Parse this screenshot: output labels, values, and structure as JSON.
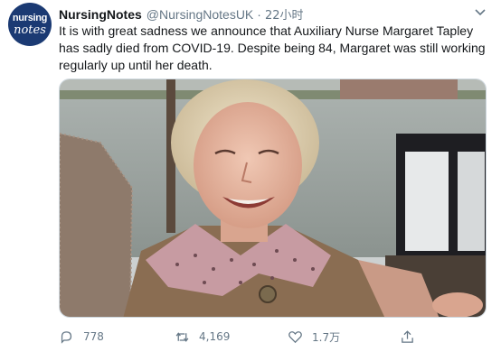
{
  "tweet": {
    "author_name": "NursingNotes",
    "handle": "@NursingNotesUK",
    "separator": "·",
    "timestamp": "22小时",
    "avatar_text_line1": "nursing",
    "avatar_text_line2": "notes",
    "body": "It is with great sadness we announce that Auxiliary Nurse Margaret Tapley has sadly died from COVID-19. Despite being 84, Margaret was still working regularly up until her death."
  },
  "actions": {
    "reply_count": "778",
    "retweet_count": "4,169",
    "like_count": "1.7万"
  },
  "colors": {
    "avatar_bg": "#1b3a73",
    "secondary_text": "#657786"
  },
  "icons": {
    "reply": "reply-icon",
    "retweet": "retweet-icon",
    "like": "heart-icon",
    "share": "share-icon",
    "menu": "chevron-down-icon"
  }
}
